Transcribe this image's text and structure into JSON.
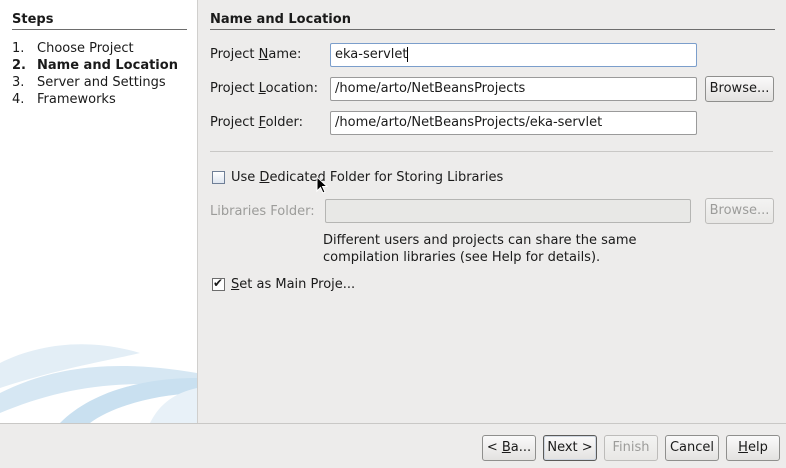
{
  "steps": {
    "title": "Steps",
    "items": [
      {
        "num": "1.",
        "label": "Choose Project"
      },
      {
        "num": "2.",
        "label": "Name and Location"
      },
      {
        "num": "3.",
        "label": "Server and Settings"
      },
      {
        "num": "4.",
        "label": "Frameworks"
      }
    ],
    "active_index": 1
  },
  "panel": {
    "title": "Name and Location",
    "project_name": {
      "label_before": "Project ",
      "mnemonic": "N",
      "label_after": "ame:",
      "value": "eka-servlet"
    },
    "project_location": {
      "label_before": "Project ",
      "mnemonic": "L",
      "label_after": "ocation:",
      "value": "/home/arto/NetBeansProjects",
      "browse_label": "Browse..."
    },
    "project_folder": {
      "label_before": "Project ",
      "mnemonic": "F",
      "label_after": "older:",
      "value": "/home/arto/NetBeansProjects/eka-servlet"
    },
    "dedicated_folder": {
      "label_before": "Use ",
      "mnemonic": "D",
      "label_after": "edicated Folder for Storing Libraries",
      "checked": false
    },
    "libraries_folder": {
      "label": "Libraries Folder:",
      "value": "",
      "browse_label": "Browse...",
      "enabled": false
    },
    "help_text": "Different users and projects can share the same compilation libraries (see Help for details).",
    "main_project": {
      "mnemonic": "S",
      "label_after": "et as Main Proje...",
      "checked": true
    }
  },
  "buttons": {
    "back": {
      "before": "< ",
      "mnemonic": "B",
      "after": "a..."
    },
    "next": "Next >",
    "finish": "Finish",
    "cancel": "Cancel",
    "help": {
      "mnemonic": "H",
      "after": "elp"
    }
  },
  "colors": {
    "focus_border": "#7b9ecb",
    "panel_bg": "#edeceb",
    "steps_bg": "#ffffff"
  }
}
